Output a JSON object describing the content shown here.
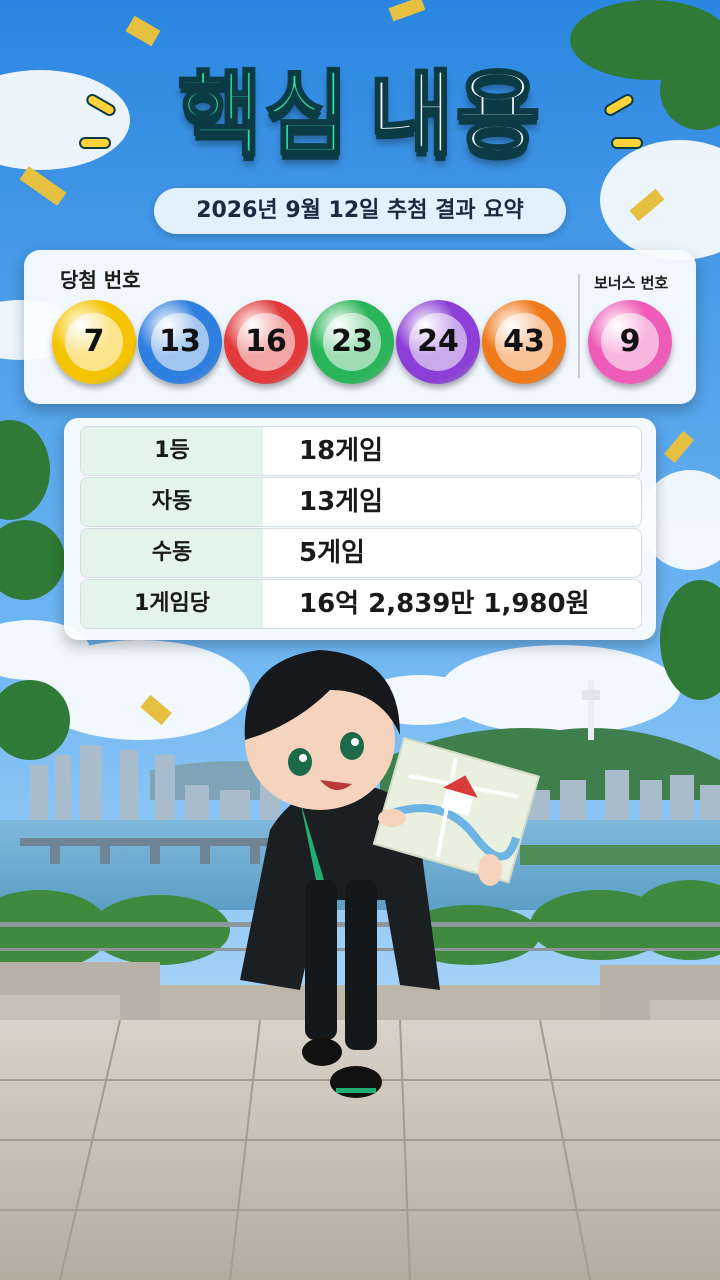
{
  "title": {
    "part1": "핵심",
    "part2": "내용"
  },
  "subtitle": "2026년 9월 12일 추첨 결과 요약",
  "winning_numbers": {
    "label": "당첨 번호",
    "numbers": [
      {
        "value": "7",
        "color": "#f5c400"
      },
      {
        "value": "13",
        "color": "#2f7fe0"
      },
      {
        "value": "16",
        "color": "#e23a3a"
      },
      {
        "value": "23",
        "color": "#2bb55a"
      },
      {
        "value": "24",
        "color": "#8b3fd6"
      },
      {
        "value": "43",
        "color": "#f07a1a"
      }
    ],
    "bonus_label": "보너스 번호",
    "bonus": {
      "value": "9",
      "color": "#ef5bb8"
    }
  },
  "prize_table": [
    {
      "key": "1등",
      "value": "18게임"
    },
    {
      "key": "자동",
      "value": "13게임"
    },
    {
      "key": "수동",
      "value": "5게임"
    },
    {
      "key": "1게임당",
      "value": "16억 2,839만 1,980원"
    }
  ]
}
